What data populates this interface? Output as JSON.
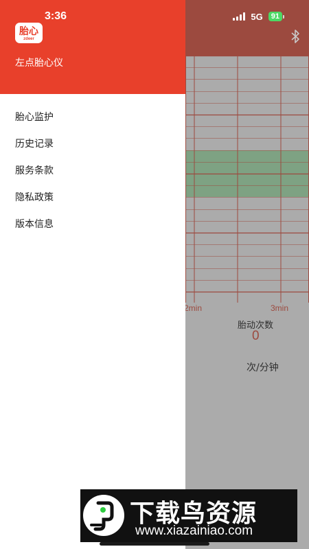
{
  "status_bar": {
    "time": "3:36",
    "network": "5G",
    "battery": "91"
  },
  "drawer": {
    "logo_text": "胎心",
    "logo_sub": "zdeer",
    "app_name": "左点胎心仪",
    "menu": [
      {
        "label": "胎心监护"
      },
      {
        "label": "历史记录"
      },
      {
        "label": "服务条款"
      },
      {
        "label": "隐私政策"
      },
      {
        "label": "版本信息"
      }
    ]
  },
  "background_app": {
    "ticks": [
      "2min",
      "3min"
    ],
    "fetal_movement_label": "胎动次数",
    "fetal_movement_value": "0",
    "unit_label": "次/分钟"
  },
  "colors": {
    "header_red": "#e8402b",
    "grid_red": "#9c4a3f",
    "green_band": "#7ea283",
    "battery_green": "#4cd964"
  },
  "watermark": {
    "title": "下载鸟资源",
    "url": "www.xiazainiao.com"
  }
}
